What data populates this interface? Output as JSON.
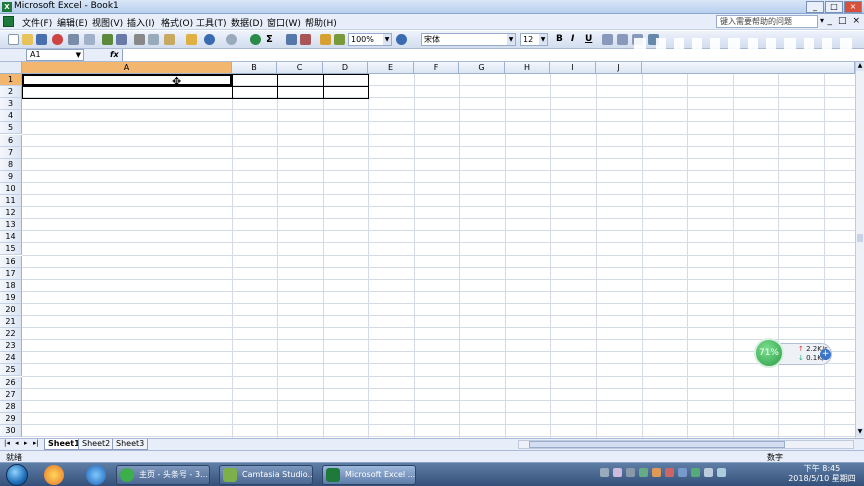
{
  "window": {
    "title": "Microsoft Excel - Book1",
    "buttons": [
      "_",
      "□",
      "×"
    ]
  },
  "menu": {
    "items": [
      "文件(F)",
      "编辑(E)",
      "视图(V)",
      "插入(I)",
      "格式(O)",
      "工具(T)",
      "数据(D)",
      "窗口(W)",
      "帮助(H)"
    ],
    "help_placeholder": "键入需要帮助的问题",
    "mdi_buttons": [
      "_",
      "□",
      "×"
    ]
  },
  "toolbar": {
    "zoom": "100%",
    "font": "宋体",
    "font_size": "12",
    "bold": "B",
    "italic": "I",
    "underline": "U"
  },
  "formula": {
    "name_box": "A1",
    "fx_label": "fx",
    "content": ""
  },
  "columns": [
    "A",
    "B",
    "C",
    "D",
    "E",
    "F",
    "G",
    "H",
    "I",
    "J"
  ],
  "active_column": "A",
  "rows": [
    "1",
    "2",
    "3",
    "4",
    "5",
    "6",
    "7",
    "8",
    "9",
    "10",
    "11",
    "12",
    "13",
    "14",
    "15",
    "16",
    "17",
    "18",
    "19",
    "20",
    "21",
    "22",
    "23",
    "24",
    "25",
    "26",
    "27",
    "28",
    "29",
    "30"
  ],
  "active_row": "1",
  "sheets": {
    "tabs": [
      "Sheet1",
      "Sheet2",
      "Sheet3"
    ],
    "active": "Sheet1"
  },
  "status": {
    "left": "就绪",
    "right": "数字"
  },
  "taskbar": {
    "tasks": [
      {
        "label": "主页 - 头条号 - 3...",
        "color": "#3cae4a"
      },
      {
        "label": "Camtasia Studio...",
        "color": "#7bb04a"
      },
      {
        "label": "Microsoft Excel ...",
        "color": "#1d7a3a"
      }
    ],
    "clock_time": "下午 8:45",
    "clock_date": "2018/5/10 星期四"
  },
  "net_widget": {
    "percent": "71%",
    "up": "2.2K/s",
    "down": "0.1K/s"
  }
}
